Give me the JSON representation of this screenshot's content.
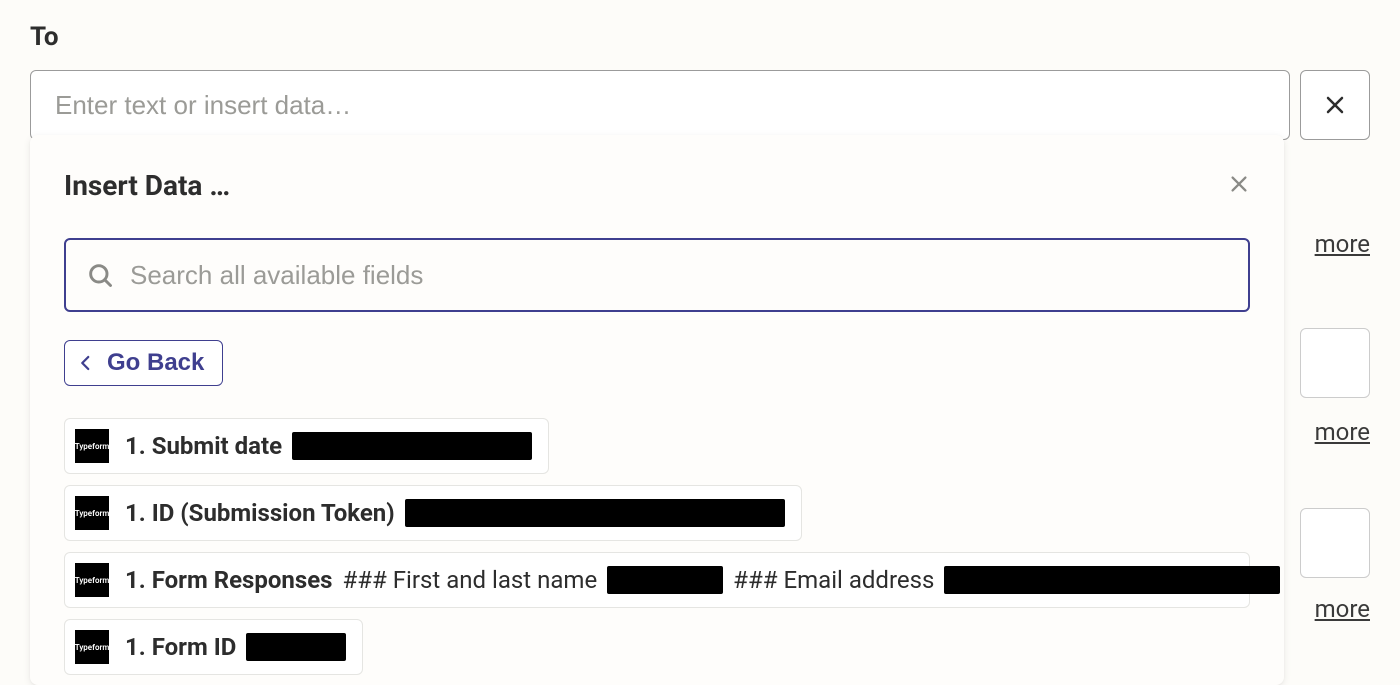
{
  "field_label": "To",
  "to_input": {
    "placeholder": "Enter text or insert data…",
    "value": ""
  },
  "more_label": "more",
  "popover": {
    "title": "Insert Data …",
    "search_placeholder": "Search all available fields",
    "go_back_label": "Go Back",
    "app_icon_label": "Typeform",
    "items": [
      {
        "bold": "1. Submit date",
        "rest": ""
      },
      {
        "bold": "1. ID (Submission Token)",
        "rest": ""
      },
      {
        "bold": "1. Form Responses",
        "rest_a": "### First and last name",
        "rest_b": "### Email address"
      },
      {
        "bold": "1. Form ID",
        "rest": ""
      }
    ]
  }
}
